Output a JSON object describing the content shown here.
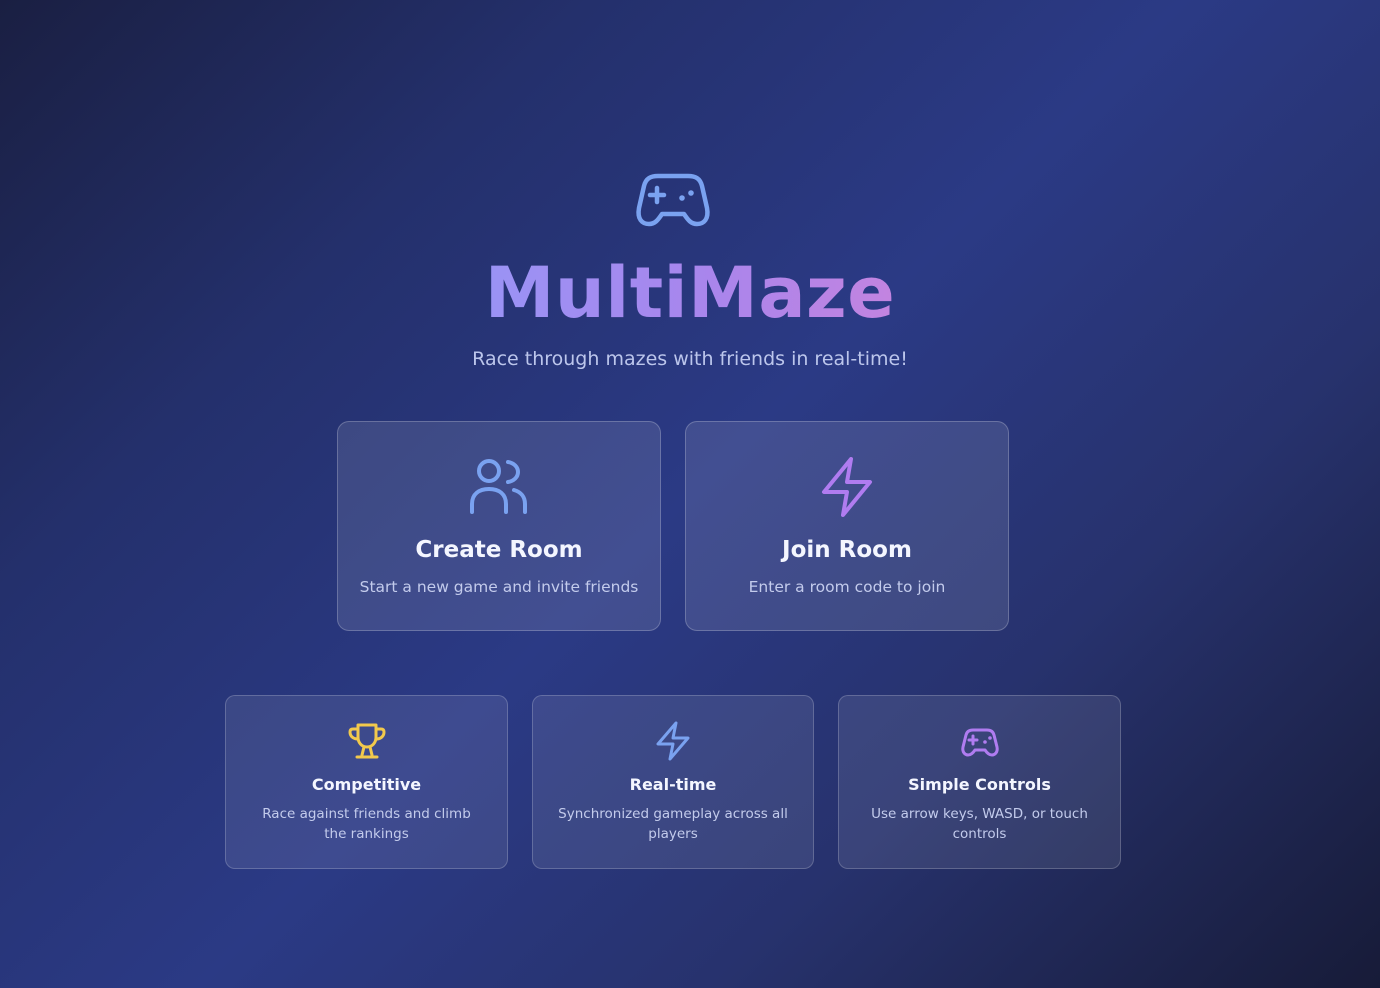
{
  "app": {
    "title": "MultiMaze",
    "subtitle": "Race through mazes with friends in real-time!",
    "logo_icon": "gamepad-icon"
  },
  "actions": [
    {
      "icon": "users-icon",
      "title": "Create Room",
      "description": "Start a new game and invite friends"
    },
    {
      "icon": "lightning-icon",
      "title": "Join Room",
      "description": "Enter a room code to join"
    }
  ],
  "features": [
    {
      "icon": "trophy-icon",
      "title": "Competitive",
      "description": "Race against friends and climb the rankings"
    },
    {
      "icon": "lightning-icon",
      "title": "Real-time",
      "description": "Synchronized gameplay across all players"
    },
    {
      "icon": "gamepad-icon",
      "title": "Simple Controls",
      "description": "Use arrow keys, WASD, or touch controls"
    }
  ],
  "colors": {
    "icon_blue": "#7aa2f0",
    "icon_purple": "#b07cf0",
    "icon_gold": "#f2c94c"
  }
}
